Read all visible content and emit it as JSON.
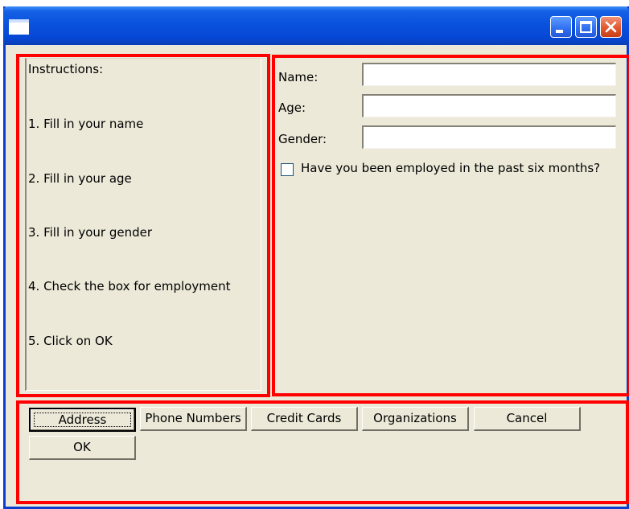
{
  "window": {
    "title": ""
  },
  "instructions": {
    "heading": "Instructions:",
    "steps": [
      "1. Fill in your name",
      "2. Fill in your age",
      "3. Fill in your gender",
      "4. Check the box for employment",
      "5. Click on OK"
    ]
  },
  "form": {
    "name_label": "Name:",
    "name_value": "",
    "age_label": "Age:",
    "age_value": "",
    "gender_label": "Gender:",
    "gender_value": "",
    "employed_label": "Have you been employed in the past six months?",
    "employed_checked": false
  },
  "buttons": {
    "address": "Address",
    "phone_numbers": "Phone Numbers",
    "credit_cards": "Credit Cards",
    "organizations": "Organizations",
    "cancel": "Cancel",
    "ok": "OK"
  },
  "colors": {
    "annotation_outline": "#ff0000",
    "titlebar": "#0a52de",
    "window_face": "#ece9d8"
  },
  "icons": {
    "window": "window-icon",
    "minimize": "minimize-icon",
    "maximize": "maximize-icon",
    "close": "close-icon"
  }
}
